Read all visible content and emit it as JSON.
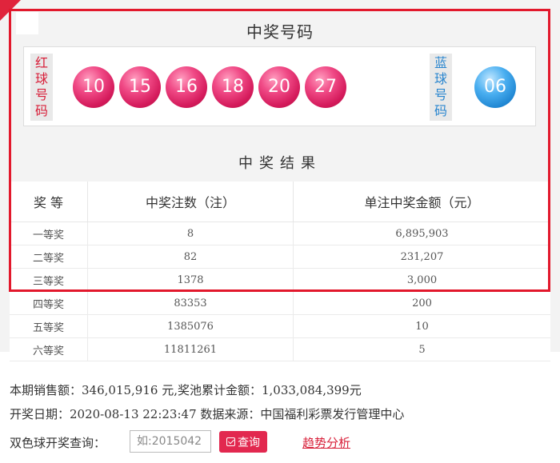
{
  "draw_panel": {
    "title": "中奖号码",
    "red_label": [
      "红",
      "球",
      "号",
      "码"
    ],
    "blue_label": [
      "蓝",
      "球",
      "号",
      "码"
    ],
    "red_balls": [
      "10",
      "15",
      "16",
      "18",
      "20",
      "27"
    ],
    "blue_ball": "06",
    "colors": {
      "red_ball": "#e0336f",
      "blue_ball": "#2a8fd8",
      "highlight_frame": "#e2182c"
    }
  },
  "results": {
    "title": "中奖结果",
    "headers": [
      "奖 等",
      "中奖注数（注）",
      "单注中奖金额（元）"
    ],
    "rows": [
      [
        "一等奖",
        "8",
        "6,895,903"
      ],
      [
        "二等奖",
        "82",
        "231,207"
      ],
      [
        "三等奖",
        "1378",
        "3,000"
      ],
      [
        "四等奖",
        "83353",
        "200"
      ],
      [
        "五等奖",
        "1385076",
        "10"
      ],
      [
        "六等奖",
        "11811261",
        "5"
      ]
    ]
  },
  "info": {
    "line1": "本期销售额：346,015,916 元,奖池累计金额：1,033,084,399元",
    "line2": "开奖日期：2020-08-13 22:23:47 数据来源：中国福利彩票发行管理中心"
  },
  "query": {
    "label": "双色球开奖查询：",
    "placeholder": "如:2015042",
    "button_label": "查询",
    "trend_link": "趋势分析"
  }
}
